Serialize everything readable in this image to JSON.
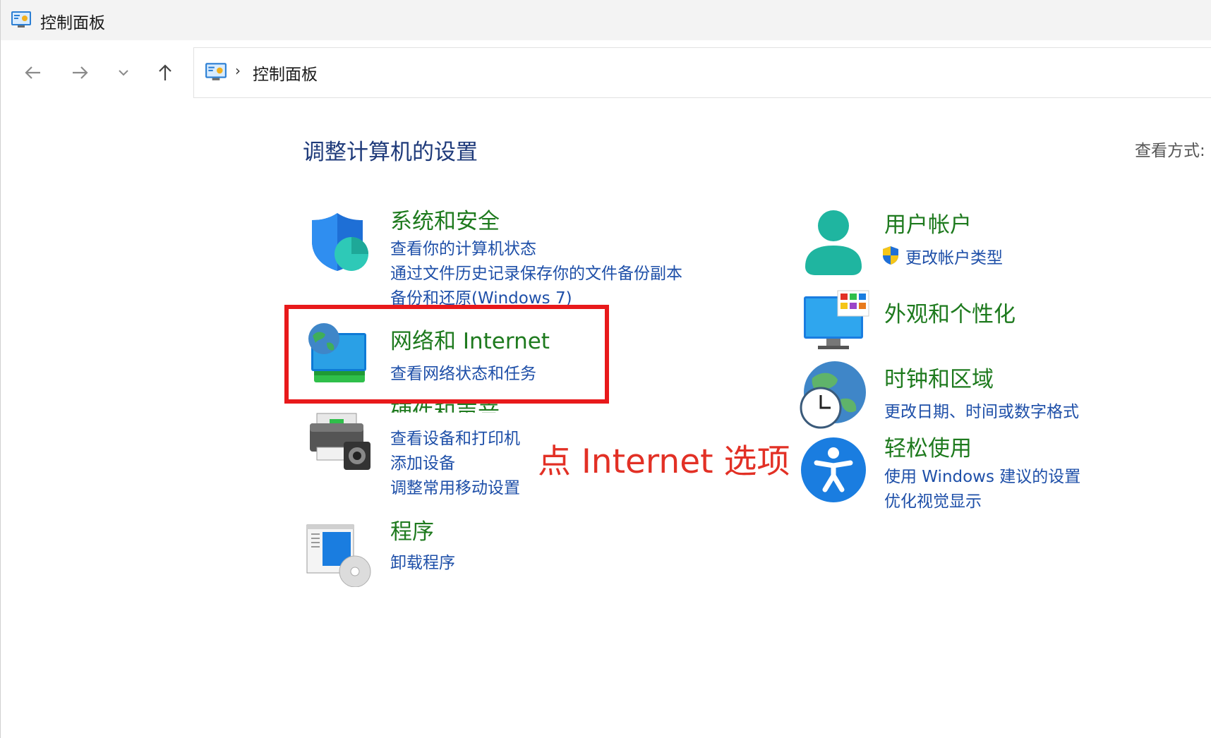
{
  "window": {
    "title": "控制面板"
  },
  "nav": {
    "back_icon": "arrow-left-icon",
    "forward_icon": "arrow-right-icon",
    "recent_icon": "chevron-down-icon",
    "up_icon": "arrow-up-icon"
  },
  "address": {
    "separator": "›",
    "crumb": "控制面板",
    "dropdown": "⌄"
  },
  "main": {
    "heading": "调整计算机的设置",
    "view_by_label": "查看方式:"
  },
  "categories": {
    "system_security": {
      "title": "系统和安全",
      "links": [
        "查看你的计算机状态",
        "通过文件历史记录保存你的文件备份副本",
        "备份和还原(Windows 7)"
      ]
    },
    "network": {
      "title": "网络和 Internet",
      "links": [
        "查看网络状态和任务"
      ]
    },
    "hardware": {
      "title": "硬件和声音",
      "links": [
        "查看设备和打印机",
        "添加设备",
        "调整常用移动设置"
      ]
    },
    "programs": {
      "title": "程序",
      "links": [
        "卸载程序"
      ]
    },
    "user_accounts": {
      "title": "用户帐户",
      "links": [
        "更改帐户类型"
      ]
    },
    "appearance": {
      "title": "外观和个性化",
      "links": []
    },
    "clock_region": {
      "title": "时钟和区域",
      "links": [
        "更改日期、时间或数字格式"
      ]
    },
    "ease_of_access": {
      "title": "轻松使用",
      "links": [
        "使用 Windows 建议的设置",
        "优化视觉显示"
      ]
    }
  },
  "annotation": {
    "text": "点 Internet 选项",
    "color": "#e23025",
    "box_color": "#e8191b"
  },
  "colors": {
    "title_green": "#1e7a1e",
    "link_blue": "#1e4fa8",
    "heading_blue": "#1e3a7a"
  }
}
